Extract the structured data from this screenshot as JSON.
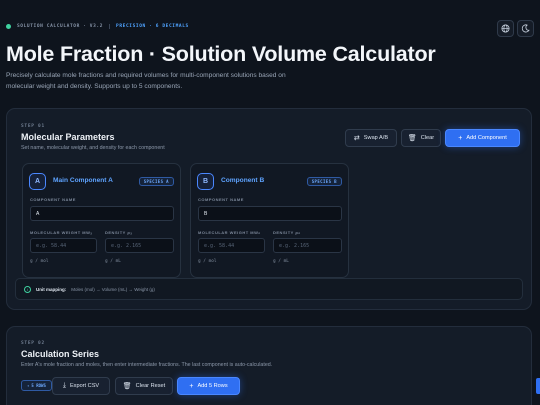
{
  "header": {
    "badge_left": "SOLUTION CALCULATOR · V3.2",
    "badge_right": "PRECISION · 6 DECIMALS",
    "title": "Mole Fraction · Solution Volume Calculator",
    "subtitle": "Precisely calculate mole fractions and required volumes for multi-component solutions based on molecular weight and density. Supports up to 5 components.",
    "icons": {
      "language": "globe-icon",
      "theme": "moon-icon"
    }
  },
  "step1": {
    "step_label": "STEP 01",
    "title": "Molecular Parameters",
    "subtitle": "Set name, molecular weight, and density for each component",
    "buttons": {
      "swap": "Swap A/B",
      "clear": "Clear",
      "add": "Add Component"
    },
    "components": [
      {
        "letter": "A",
        "name": "Main Component A",
        "species": "SPECIES A",
        "name_label": "COMPONENT NAME",
        "name_value": "A",
        "mw_label": "MOLECULAR WEIGHT MWₐ",
        "mw_placeholder": "e.g. 58.44",
        "mw_unit": "g / mol",
        "density_label": "DENSITY ρₐ",
        "density_placeholder": "e.g. 2.165",
        "density_unit": "g / mL"
      },
      {
        "letter": "B",
        "name": "Component B",
        "species": "SPECIES B",
        "name_label": "COMPONENT NAME",
        "name_value": "B",
        "mw_label": "MOLECULAR WEIGHT MWₙ",
        "mw_placeholder": "e.g. 58.44",
        "mw_unit": "g / mol",
        "density_label": "DENSITY ρₙ",
        "density_placeholder": "e.g. 2.165",
        "density_unit": "g / mL"
      }
    ],
    "mapping_label": "Unit mapping:",
    "mapping_text": "Moles (mol) → Volume (mL) → Weight (g)"
  },
  "step2": {
    "step_label": "STEP 02",
    "title": "Calculation Series",
    "subtitle": "Enter A's mole fraction and moles, then enter intermediate fractions. The last component is auto-calculated.",
    "rows_chip": "5 ROWS",
    "buttons": {
      "export": "Export CSV",
      "clear": "Clear Reset",
      "add": "Add 5 Rows"
    }
  },
  "colors": {
    "accent": "#2f6ff2",
    "status": "#3fd2a0",
    "background": "#0e141d"
  }
}
